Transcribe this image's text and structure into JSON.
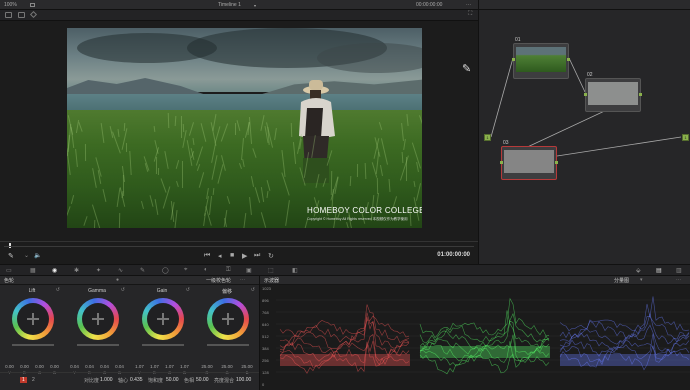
{
  "topbar": {
    "zoom": "100%",
    "timeline_name": "Timeline 1",
    "timecode": "00:00:00:00",
    "node_panel_title": "剪辑"
  },
  "viewer": {
    "watermark_title": "HOMEBOY COLOR COLLEGE",
    "watermark_subtitle": "Copyright © Homeboy All Rights reserved 本视频仅作为教学使用"
  },
  "transport": {
    "timecode": "01:00:00:00"
  },
  "nodes": [
    {
      "id": "01"
    },
    {
      "id": "02"
    },
    {
      "id": "03"
    }
  ],
  "node_io": {
    "in": "1",
    "out": "1"
  },
  "wheels_panel": {
    "title": "色轮",
    "mode": "一级校色轮",
    "wheels": [
      {
        "name": "Lift",
        "values": [
          "0.00",
          "0.00",
          "0.00",
          "0.00"
        ],
        "labels": [
          "Y",
          "R",
          "G",
          "B"
        ]
      },
      {
        "name": "Gamma",
        "values": [
          "0.04",
          "0.04",
          "0.04",
          "0.04"
        ],
        "labels": [
          "Y",
          "R",
          "G",
          "B"
        ]
      },
      {
        "name": "Gain",
        "values": [
          "1.07",
          "1.07",
          "1.07",
          "1.07"
        ],
        "labels": [
          "Y",
          "R",
          "G",
          "B"
        ]
      },
      {
        "name": "偏移",
        "values": [
          "25.00",
          "25.00",
          "25.00"
        ],
        "labels": [
          "R",
          "G",
          "B"
        ]
      }
    ],
    "footer": {
      "page_a": "1",
      "page_b": "2",
      "contrast_label": "对比度",
      "contrast_value": "1.000",
      "pivot_label": "轴心",
      "pivot_value": "0.435",
      "sat_label": "饱和度",
      "sat_value": "50.00",
      "hue_label": "色相",
      "hue_value": "50.00",
      "lum_label": "亮度混合",
      "lum_value": "100.00"
    }
  },
  "scopes": {
    "title": "示波器",
    "mode": "分量图",
    "y_ticks": [
      "1023",
      "896",
      "768",
      "640",
      "512",
      "384",
      "256",
      "128",
      "0"
    ],
    "colors": {
      "red": "#ff5a5a",
      "green": "#5aff6a",
      "blue": "#6a7dff"
    }
  }
}
